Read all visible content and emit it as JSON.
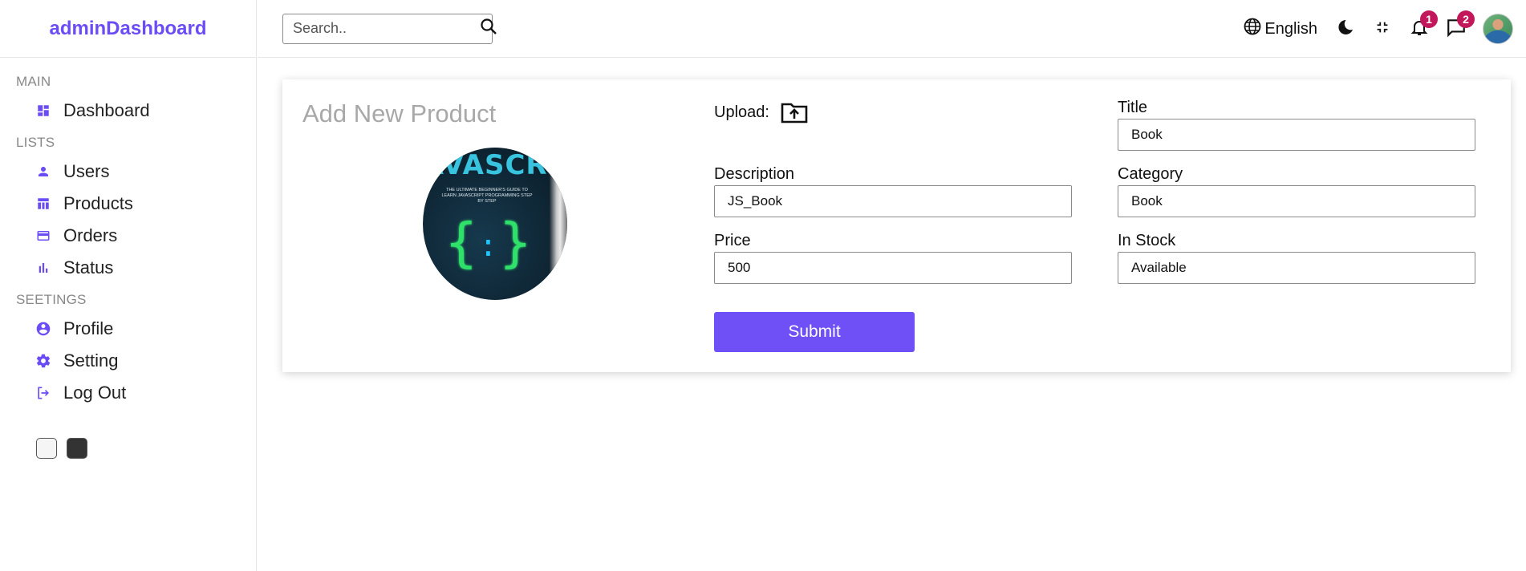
{
  "brand": {
    "logo": "adminDashboard",
    "accent": "#6c4cf5"
  },
  "sidebar": {
    "sections": [
      {
        "title": "MAIN",
        "items": [
          {
            "label": "Dashboard",
            "icon": "dashboard-icon"
          }
        ]
      },
      {
        "title": "LISTS",
        "items": [
          {
            "label": "Users",
            "icon": "person-icon"
          },
          {
            "label": "Products",
            "icon": "table-icon"
          },
          {
            "label": "Orders",
            "icon": "credit-card-icon"
          },
          {
            "label": "Status",
            "icon": "bar-chart-icon"
          }
        ]
      },
      {
        "title": "SEETINGS",
        "items": [
          {
            "label": "Profile",
            "icon": "account-circle-icon"
          },
          {
            "label": "Setting",
            "icon": "gear-icon"
          },
          {
            "label": "Log Out",
            "icon": "logout-icon"
          }
        ]
      }
    ],
    "themes": [
      "light",
      "dark"
    ]
  },
  "topbar": {
    "search_placeholder": "Search..",
    "language": "English",
    "notifications_count": "1",
    "messages_count": "2",
    "badge_color": "#c2185b"
  },
  "form": {
    "title": "Add New Product",
    "upload_label": "Upload:",
    "preview_image": {
      "book_title": "JAVASCRIPT",
      "book_subtitle": "THE ULTIMATE BEGINNER'S GUIDE TO LEARN JAVASCRIPT PROGRAMMING STEP BY STEP"
    },
    "fields": {
      "title": {
        "label": "Title",
        "value": "Book"
      },
      "description": {
        "label": "Description",
        "value": "JS_Book"
      },
      "category": {
        "label": "Category",
        "value": "Book"
      },
      "price": {
        "label": "Price",
        "value": "500"
      },
      "in_stock": {
        "label": "In Stock",
        "value": "Available"
      }
    },
    "submit_label": "Submit",
    "submit_color": "#6f4ff6"
  }
}
